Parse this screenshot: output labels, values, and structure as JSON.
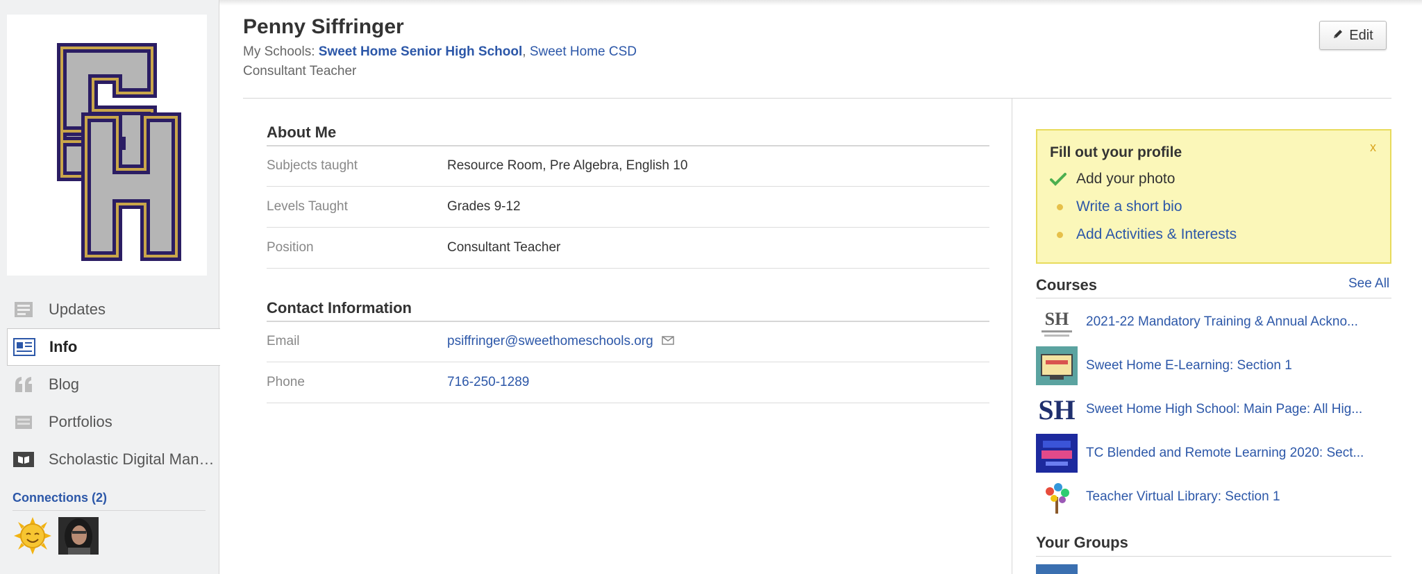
{
  "profile": {
    "name": "Penny Siffringer",
    "schools_prefix": "My Schools: ",
    "school_primary": "Sweet Home Senior High School",
    "school_separator": ",",
    "school_district": "Sweet Home CSD",
    "role": "Consultant Teacher",
    "edit_label": "Edit"
  },
  "sidebar": {
    "nav": [
      {
        "label": "Updates",
        "icon": "updates-icon"
      },
      {
        "label": "Info",
        "icon": "info-icon",
        "active": true
      },
      {
        "label": "Blog",
        "icon": "quote-icon"
      },
      {
        "label": "Portfolios",
        "icon": "portfolio-icon"
      },
      {
        "label": "Scholastic Digital Mana...",
        "icon": "book-icon"
      }
    ],
    "connections_title": "Connections (2)"
  },
  "about": {
    "title": "About Me",
    "rows": [
      {
        "key": "Subjects taught",
        "value": "Resource Room, Pre Algebra, English 10"
      },
      {
        "key": "Levels Taught",
        "value": "Grades 9-12"
      },
      {
        "key": "Position",
        "value": "Consultant Teacher"
      }
    ]
  },
  "contact": {
    "title": "Contact Information",
    "rows": [
      {
        "key": "Email",
        "value": "psiffringer@sweethomeschools.org",
        "icon": "mail-icon"
      },
      {
        "key": "Phone",
        "value": "716-250-1289"
      }
    ]
  },
  "fill_profile": {
    "title": "Fill out your profile",
    "close": "x",
    "items": [
      {
        "label": "Add your photo",
        "done": true
      },
      {
        "label": "Write a short bio",
        "done": false
      },
      {
        "label": "Add Activities & Interests",
        "done": false
      }
    ]
  },
  "courses": {
    "title": "Courses",
    "see_all": "See All",
    "items": [
      {
        "title": "2021-22 Mandatory Training & Annual Ackno..."
      },
      {
        "title": "Sweet Home E-Learning: Section 1"
      },
      {
        "title": "Sweet Home High School: Main Page: All Hig..."
      },
      {
        "title": "TC Blended and Remote Learning 2020: Sect..."
      },
      {
        "title": "Teacher Virtual Library: Section 1"
      }
    ]
  },
  "groups": {
    "title": "Your Groups"
  },
  "colors": {
    "link": "#2c57a8",
    "notice_bg": "#fbf7b9",
    "notice_border": "#e8db5c",
    "check": "#4caf50"
  }
}
